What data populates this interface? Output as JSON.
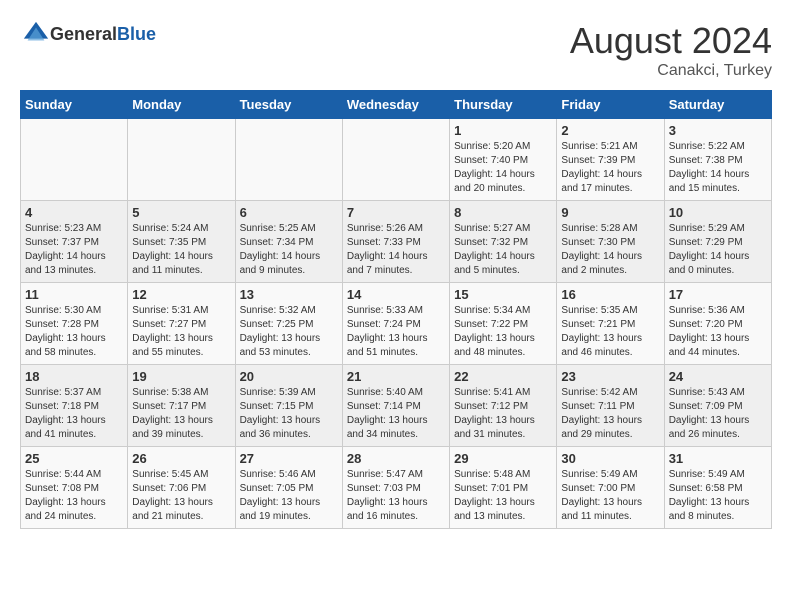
{
  "header": {
    "logo_general": "General",
    "logo_blue": "Blue",
    "month_year": "August 2024",
    "location": "Canakci, Turkey"
  },
  "days_of_week": [
    "Sunday",
    "Monday",
    "Tuesday",
    "Wednesday",
    "Thursday",
    "Friday",
    "Saturday"
  ],
  "weeks": [
    [
      {
        "day": "",
        "info": ""
      },
      {
        "day": "",
        "info": ""
      },
      {
        "day": "",
        "info": ""
      },
      {
        "day": "",
        "info": ""
      },
      {
        "day": "1",
        "info": "Sunrise: 5:20 AM\nSunset: 7:40 PM\nDaylight: 14 hours and 20 minutes."
      },
      {
        "day": "2",
        "info": "Sunrise: 5:21 AM\nSunset: 7:39 PM\nDaylight: 14 hours and 17 minutes."
      },
      {
        "day": "3",
        "info": "Sunrise: 5:22 AM\nSunset: 7:38 PM\nDaylight: 14 hours and 15 minutes."
      }
    ],
    [
      {
        "day": "4",
        "info": "Sunrise: 5:23 AM\nSunset: 7:37 PM\nDaylight: 14 hours and 13 minutes."
      },
      {
        "day": "5",
        "info": "Sunrise: 5:24 AM\nSunset: 7:35 PM\nDaylight: 14 hours and 11 minutes."
      },
      {
        "day": "6",
        "info": "Sunrise: 5:25 AM\nSunset: 7:34 PM\nDaylight: 14 hours and 9 minutes."
      },
      {
        "day": "7",
        "info": "Sunrise: 5:26 AM\nSunset: 7:33 PM\nDaylight: 14 hours and 7 minutes."
      },
      {
        "day": "8",
        "info": "Sunrise: 5:27 AM\nSunset: 7:32 PM\nDaylight: 14 hours and 5 minutes."
      },
      {
        "day": "9",
        "info": "Sunrise: 5:28 AM\nSunset: 7:30 PM\nDaylight: 14 hours and 2 minutes."
      },
      {
        "day": "10",
        "info": "Sunrise: 5:29 AM\nSunset: 7:29 PM\nDaylight: 14 hours and 0 minutes."
      }
    ],
    [
      {
        "day": "11",
        "info": "Sunrise: 5:30 AM\nSunset: 7:28 PM\nDaylight: 13 hours and 58 minutes."
      },
      {
        "day": "12",
        "info": "Sunrise: 5:31 AM\nSunset: 7:27 PM\nDaylight: 13 hours and 55 minutes."
      },
      {
        "day": "13",
        "info": "Sunrise: 5:32 AM\nSunset: 7:25 PM\nDaylight: 13 hours and 53 minutes."
      },
      {
        "day": "14",
        "info": "Sunrise: 5:33 AM\nSunset: 7:24 PM\nDaylight: 13 hours and 51 minutes."
      },
      {
        "day": "15",
        "info": "Sunrise: 5:34 AM\nSunset: 7:22 PM\nDaylight: 13 hours and 48 minutes."
      },
      {
        "day": "16",
        "info": "Sunrise: 5:35 AM\nSunset: 7:21 PM\nDaylight: 13 hours and 46 minutes."
      },
      {
        "day": "17",
        "info": "Sunrise: 5:36 AM\nSunset: 7:20 PM\nDaylight: 13 hours and 44 minutes."
      }
    ],
    [
      {
        "day": "18",
        "info": "Sunrise: 5:37 AM\nSunset: 7:18 PM\nDaylight: 13 hours and 41 minutes."
      },
      {
        "day": "19",
        "info": "Sunrise: 5:38 AM\nSunset: 7:17 PM\nDaylight: 13 hours and 39 minutes."
      },
      {
        "day": "20",
        "info": "Sunrise: 5:39 AM\nSunset: 7:15 PM\nDaylight: 13 hours and 36 minutes."
      },
      {
        "day": "21",
        "info": "Sunrise: 5:40 AM\nSunset: 7:14 PM\nDaylight: 13 hours and 34 minutes."
      },
      {
        "day": "22",
        "info": "Sunrise: 5:41 AM\nSunset: 7:12 PM\nDaylight: 13 hours and 31 minutes."
      },
      {
        "day": "23",
        "info": "Sunrise: 5:42 AM\nSunset: 7:11 PM\nDaylight: 13 hours and 29 minutes."
      },
      {
        "day": "24",
        "info": "Sunrise: 5:43 AM\nSunset: 7:09 PM\nDaylight: 13 hours and 26 minutes."
      }
    ],
    [
      {
        "day": "25",
        "info": "Sunrise: 5:44 AM\nSunset: 7:08 PM\nDaylight: 13 hours and 24 minutes."
      },
      {
        "day": "26",
        "info": "Sunrise: 5:45 AM\nSunset: 7:06 PM\nDaylight: 13 hours and 21 minutes."
      },
      {
        "day": "27",
        "info": "Sunrise: 5:46 AM\nSunset: 7:05 PM\nDaylight: 13 hours and 19 minutes."
      },
      {
        "day": "28",
        "info": "Sunrise: 5:47 AM\nSunset: 7:03 PM\nDaylight: 13 hours and 16 minutes."
      },
      {
        "day": "29",
        "info": "Sunrise: 5:48 AM\nSunset: 7:01 PM\nDaylight: 13 hours and 13 minutes."
      },
      {
        "day": "30",
        "info": "Sunrise: 5:49 AM\nSunset: 7:00 PM\nDaylight: 13 hours and 11 minutes."
      },
      {
        "day": "31",
        "info": "Sunrise: 5:49 AM\nSunset: 6:58 PM\nDaylight: 13 hours and 8 minutes."
      }
    ]
  ]
}
